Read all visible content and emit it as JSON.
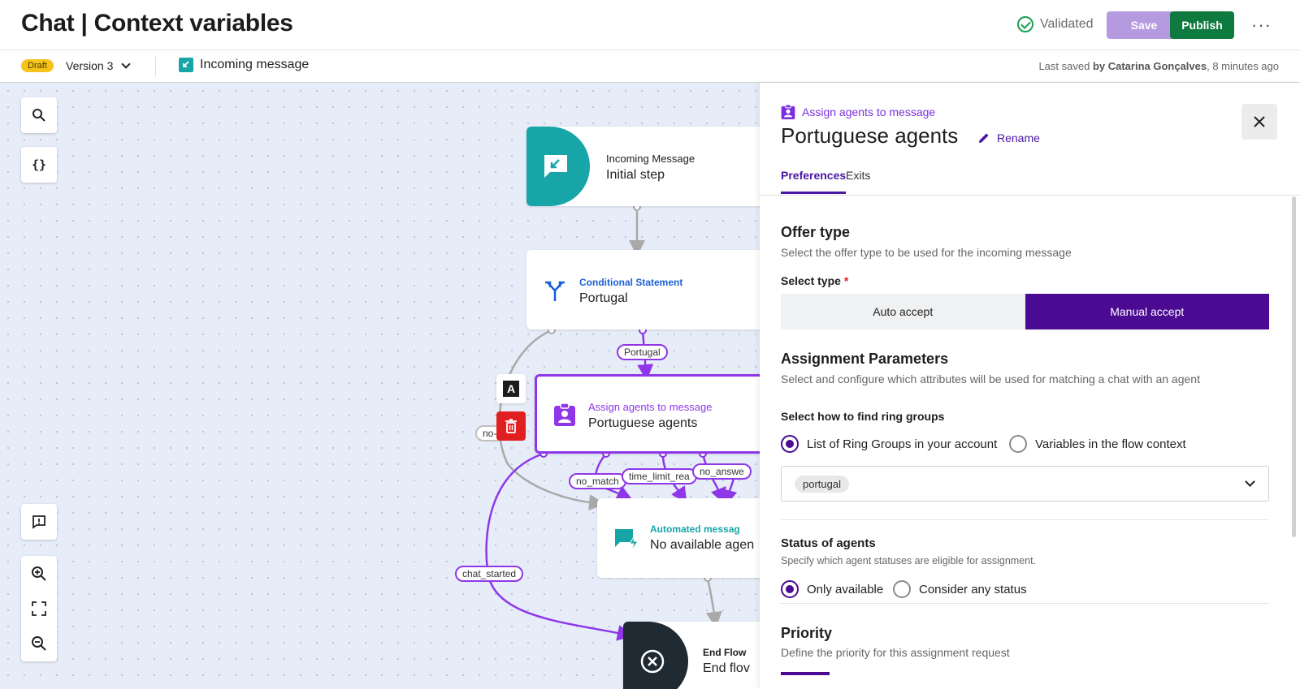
{
  "header": {
    "title": "Chat | Context variables",
    "validated_label": "Validated",
    "save_label": "Save",
    "publish_label": "Publish",
    "more_label": "···"
  },
  "subbar": {
    "status_badge": "Draft",
    "version_label": "Version 3",
    "trigger_label": "Incoming message",
    "last_saved_prefix": "Last saved",
    "last_saved_by": "by Catarina Gonçalves",
    "last_saved_time": ", 8 minutes ago"
  },
  "canvas": {
    "tools": {
      "search_icon": "search-icon",
      "variables_label": "{}"
    },
    "nodes": {
      "incoming": {
        "type": "Incoming Message",
        "name": "Initial step",
        "color": "#17a5a8"
      },
      "conditional": {
        "type": "Conditional Statement",
        "name": "Portugal",
        "color": "#1a5fd8"
      },
      "assign": {
        "type": "Assign agents to message",
        "name": "Portuguese agents",
        "color": "#8f37e8"
      },
      "automated": {
        "type": "Automated messag",
        "name": "No available agen",
        "color": "#17a5a8"
      },
      "end": {
        "type": "End Flow",
        "name": "End flov"
      }
    },
    "edge_labels": {
      "portugal": "Portugal",
      "no_left": "no-",
      "no_match": "no_match",
      "time_limit": "time_limit_rea",
      "no_answer": "no_answe",
      "chat_started": "chat_started"
    },
    "node_actions": {
      "annotate_label": "A"
    }
  },
  "panel": {
    "node_type": "Assign agents to message",
    "title": "Portuguese agents",
    "rename_label": "Rename",
    "tabs": [
      {
        "label": "Preferences",
        "active": true
      },
      {
        "label": "Exits",
        "active": false
      }
    ],
    "offer_type": {
      "heading": "Offer type",
      "description": "Select the offer type to be used for the incoming message",
      "select_label": "Select type",
      "required_mark": "*",
      "options": [
        "Auto accept",
        "Manual accept"
      ],
      "selected": "Manual accept"
    },
    "assignment": {
      "heading": "Assignment Parameters",
      "description": "Select and configure which attributes will be used for matching a chat with an agent",
      "ring_groups_label": "Select how to find ring groups",
      "ring_group_options": [
        "List of Ring Groups in your account",
        "Variables in the flow context"
      ],
      "ring_group_selected": "List of Ring Groups in your account",
      "selected_chip": "portugal"
    },
    "status": {
      "heading": "Status of agents",
      "description": "Specify which agent statuses are eligible for assignment.",
      "options": [
        "Only available",
        "Consider any status"
      ],
      "selected": "Only available"
    },
    "priority": {
      "heading": "Priority",
      "description": "Define the priority for this assignment request"
    }
  },
  "colors": {
    "accent_purple": "#4a0a91",
    "node_purple": "#8f37e8",
    "publish_green": "#0f7a3f",
    "save_disabled": "#b69ae0",
    "draft_yellow": "#f6c31c",
    "canvas_bg": "#e6edf8"
  }
}
